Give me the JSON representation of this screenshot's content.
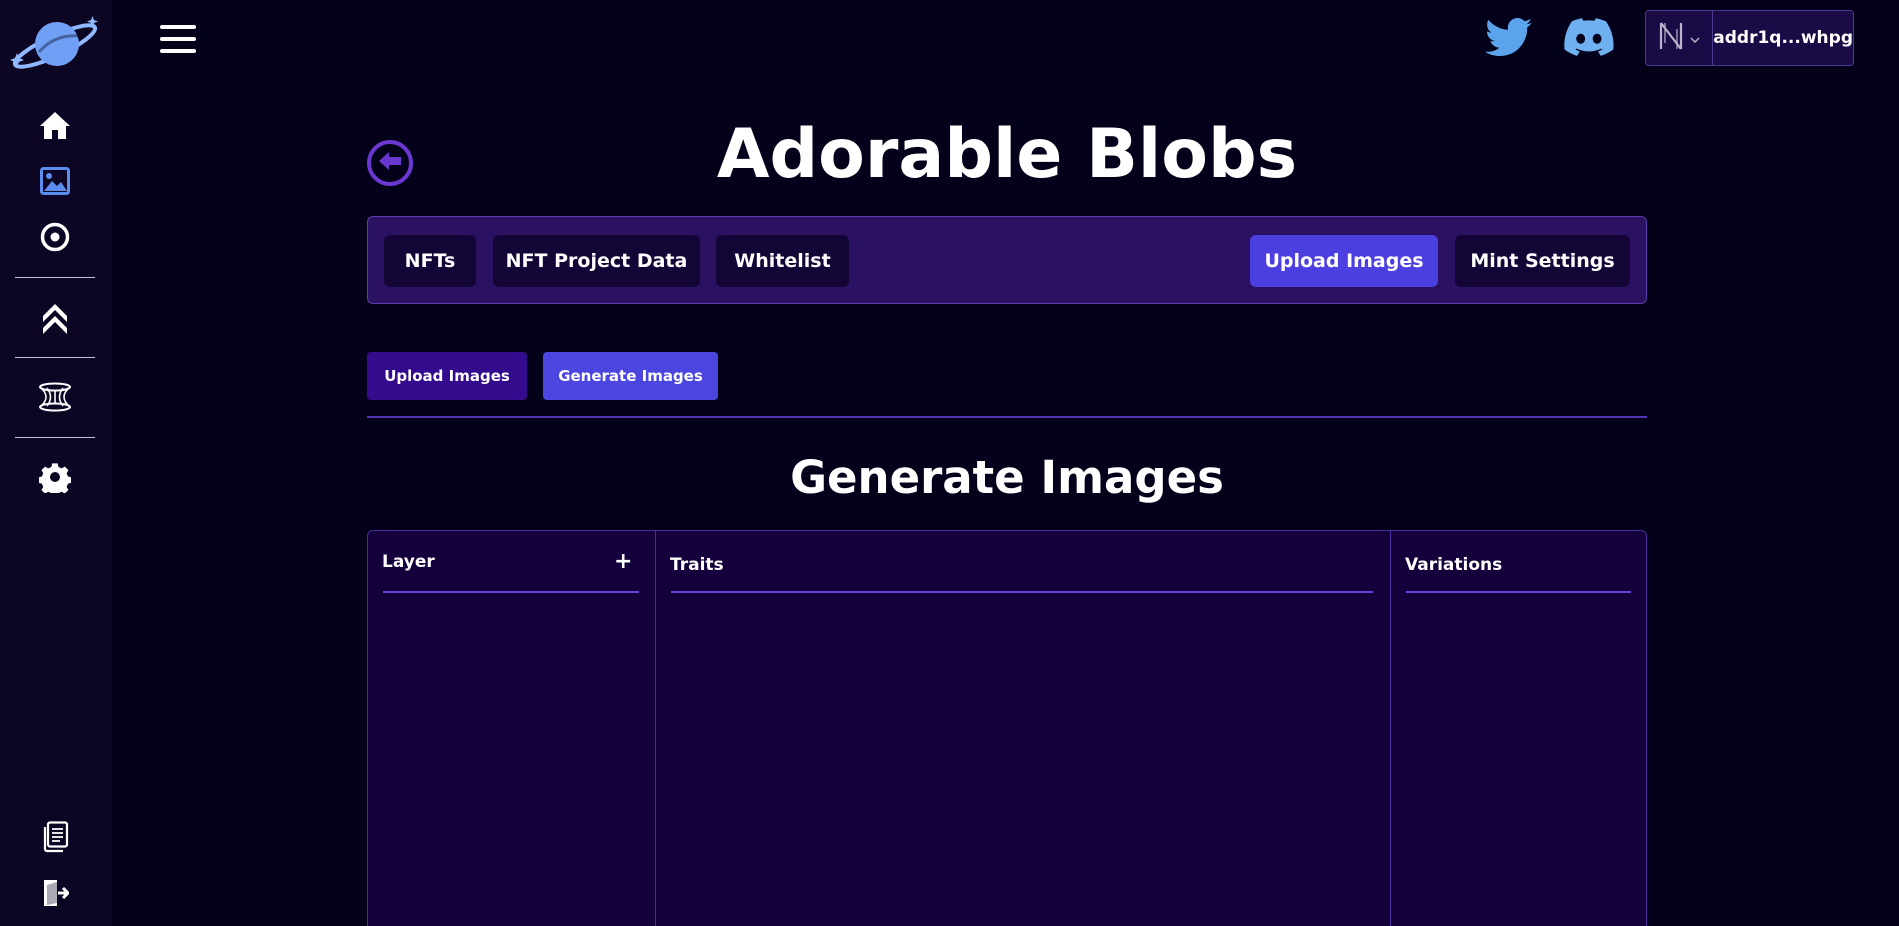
{
  "sidebar": {
    "logo_icon": "planet-logo-icon",
    "items": [
      {
        "icon": "home-icon"
      },
      {
        "icon": "image-icon"
      },
      {
        "icon": "compass-icon"
      },
      {
        "icon": "chevrons-up-icon"
      },
      {
        "icon": "tornado-icon"
      },
      {
        "icon": "gear-icon"
      }
    ],
    "bottom_items": [
      {
        "icon": "documents-icon"
      },
      {
        "icon": "logout-icon"
      }
    ]
  },
  "topbar": {
    "menu_icon": "hamburger-menu-icon",
    "social": [
      {
        "icon": "twitter-icon"
      },
      {
        "icon": "discord-icon"
      }
    ],
    "wallet": {
      "network_icon": "network-icon",
      "address": "addr1q...whpg"
    }
  },
  "project": {
    "title": "Adorable Blobs",
    "back_icon": "arrow-left-icon"
  },
  "tabs": [
    {
      "label": "NFTs",
      "active": false
    },
    {
      "label": "NFT Project Data",
      "active": false
    },
    {
      "label": "Whitelist",
      "active": false
    },
    {
      "label": "Upload Images",
      "active": true
    },
    {
      "label": "Mint Settings",
      "active": false
    }
  ],
  "subtabs": [
    {
      "label": "Upload Images"
    },
    {
      "label": "Generate Images",
      "active": true
    }
  ],
  "section": {
    "title": "Generate Images"
  },
  "generator": {
    "layer_header": "Layer",
    "add_label": "+",
    "traits_header": "Traits",
    "variations_header": "Variations"
  },
  "colors": {
    "background": "#04011a",
    "sidebar": "#0d0524",
    "accent": "#4c3fe0",
    "panel": "#14003b",
    "tabbar": "#2b1162"
  }
}
